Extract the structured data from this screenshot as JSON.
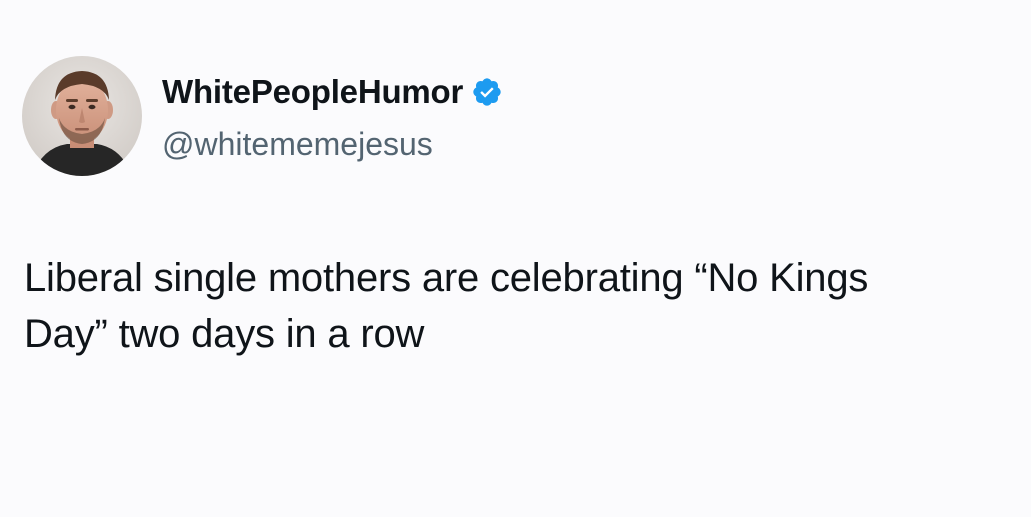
{
  "tweet": {
    "display_name": "WhitePeopleHumor",
    "handle": "@whitememejesus",
    "verified": true,
    "verified_icon": "verified-badge-icon",
    "avatar_icon": "profile-photo",
    "text_lines": [
      "Liberal single mothers are celebrating “No Kings",
      "Day” two days in a row"
    ]
  },
  "colors": {
    "background": "#fbfbfd",
    "text": "#0f1419",
    "handle": "#536471",
    "verified": "#1d9bf0"
  }
}
